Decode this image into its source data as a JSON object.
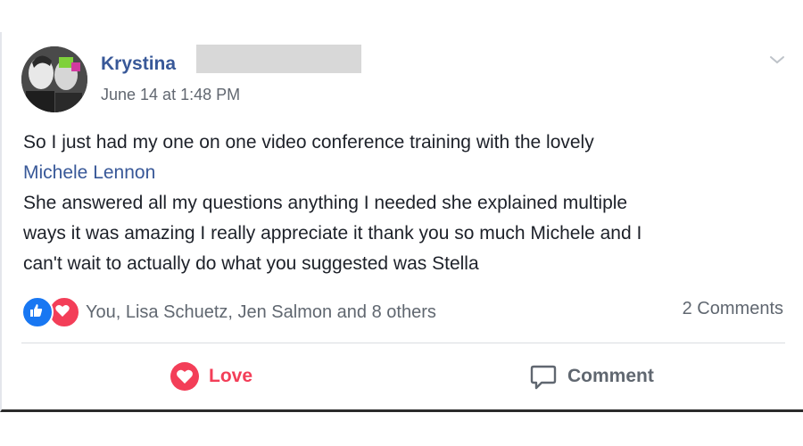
{
  "post": {
    "author": "Krystina",
    "timestamp": "June 14 at 1:48 PM",
    "text_lines": [
      "So I just had my one on one video conference training with the lovely",
      "Michele Lennon",
      "She answered all my questions anything I needed she explained multiple",
      "ways it was amazing I really appreciate it thank you so much Michele and I",
      "can't wait to actually do what you suggested was Stella"
    ]
  },
  "reactions": {
    "icons": [
      "like-icon",
      "love-icon"
    ],
    "summary": "You, Lisa Schuetz, Jen Salmon and 8 others",
    "comments": "2 Comments"
  },
  "actions": {
    "love_label": "Love",
    "comment_label": "Comment"
  },
  "colors": {
    "link": "#385898",
    "love": "#f33e58",
    "like": "#1877f2",
    "meta": "#616770"
  }
}
